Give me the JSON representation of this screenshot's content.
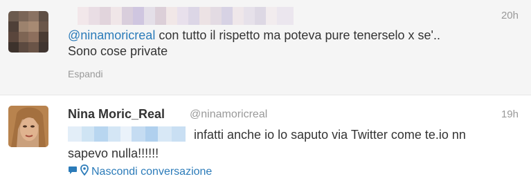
{
  "tweet1": {
    "time": "20h",
    "mention": "@ninamoricreal",
    "text_line1_rest": " con tutto il rispetto ma poteva pure tenerselo x se'..",
    "text_line2": "Sono cose private",
    "expand_label": "Espandi"
  },
  "tweet2": {
    "display_name": "Nina Moric_Real",
    "handle": "@ninamoricreal",
    "time": "19h",
    "text_line1": "infatti anche io lo saputo via Twitter come te.io nn",
    "text_line2": "sapevo nulla!!!!!!",
    "conversation_label": "Nascondi conversazione"
  },
  "icons": {
    "reply": "speech-bubble-icon",
    "location": "map-pin-icon"
  },
  "colors": {
    "link": "#2b7bb9",
    "muted": "#999999",
    "text": "#333333"
  }
}
